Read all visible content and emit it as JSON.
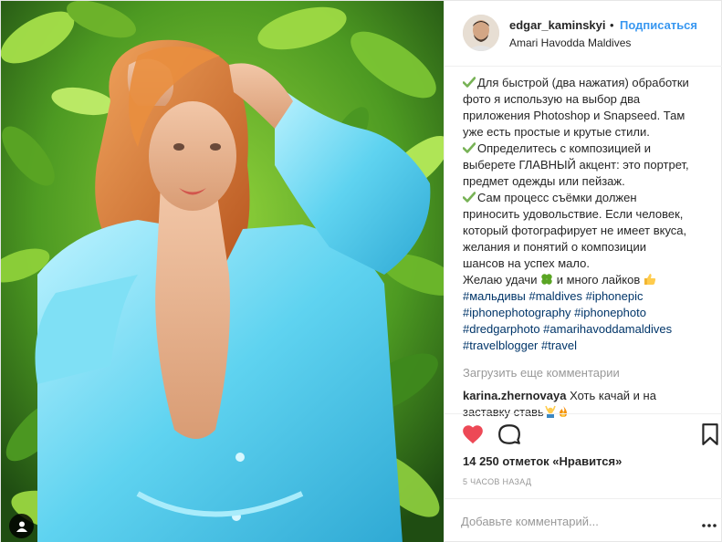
{
  "post": {
    "username": "edgar_kaminskyi",
    "separator": "•",
    "follow_label": "Подписаться",
    "location": "Amari Havodda Maldives"
  },
  "caption": {
    "lines": [
      "Для быстрой (два нажатия) обработки",
      "фото я использую на выбор два",
      "приложения Photoshop и Snapseed. Там",
      "уже есть простые и крутые стили.",
      "Определитесь с композицией и",
      "выберете ГЛАВНЫЙ акцент: это портрет,",
      "предмет одежды или пейзаж.",
      "Сам процесс съёмки должен",
      "приносить удовольствие. Если человек,",
      "который фотографирует не имеет вкуса,",
      "желания и понятий о композиции",
      "шансов на успех мало.",
      "Желаю удачи",
      "и много лайков"
    ],
    "hashtag_lines": [
      "#мальдивы #maldives #iphonepic",
      "#iphonephotography #iphonephoto",
      "#dredgarphoto #amarihavoddamaldives",
      "#travelblogger #travel"
    ]
  },
  "load_more_label": "Загрузить еще комментарии",
  "comment": {
    "user": "karina.zhernovaya",
    "text_line1": "Хоть качай и на",
    "text_line2": "заставку ставь"
  },
  "likes_text": "14 250 отметок «Нравится»",
  "time_text": "5 часов назад",
  "add_comment_placeholder": "Добавьте комментарий...",
  "icons": {
    "like": "heart-filled-icon",
    "comment": "comment-bubble-icon",
    "save": "bookmark-icon",
    "more": "more-dots-icon",
    "check": "check-mark-emoji",
    "clover": "four-leaf-clover-emoji",
    "thumbs": "thumbs-up-emoji",
    "tagged": "person-tag-icon"
  },
  "colors": {
    "link_blue": "#3897f0",
    "hashtag_blue": "#003569",
    "heart_red": "#ed4956",
    "check_green": "#77b255",
    "muted_gray": "#999999",
    "text_dark": "#262626"
  }
}
